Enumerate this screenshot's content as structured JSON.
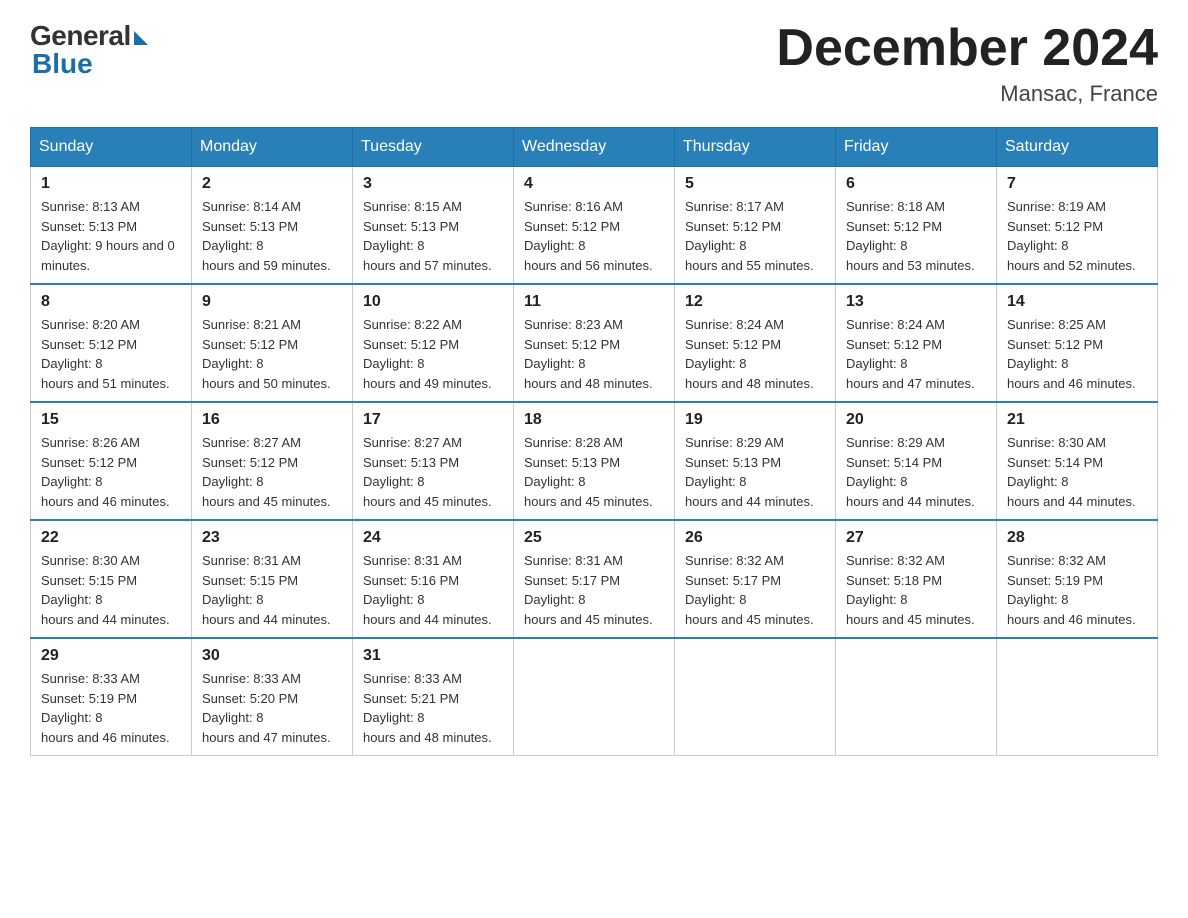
{
  "header": {
    "logo_general": "General",
    "logo_blue": "Blue",
    "month_title": "December 2024",
    "location": "Mansac, France"
  },
  "days_of_week": [
    "Sunday",
    "Monday",
    "Tuesday",
    "Wednesday",
    "Thursday",
    "Friday",
    "Saturday"
  ],
  "weeks": [
    [
      {
        "day": "1",
        "sunrise": "8:13 AM",
        "sunset": "5:13 PM",
        "daylight": "9 hours and 0 minutes."
      },
      {
        "day": "2",
        "sunrise": "8:14 AM",
        "sunset": "5:13 PM",
        "daylight": "8 hours and 59 minutes."
      },
      {
        "day": "3",
        "sunrise": "8:15 AM",
        "sunset": "5:13 PM",
        "daylight": "8 hours and 57 minutes."
      },
      {
        "day": "4",
        "sunrise": "8:16 AM",
        "sunset": "5:12 PM",
        "daylight": "8 hours and 56 minutes."
      },
      {
        "day": "5",
        "sunrise": "8:17 AM",
        "sunset": "5:12 PM",
        "daylight": "8 hours and 55 minutes."
      },
      {
        "day": "6",
        "sunrise": "8:18 AM",
        "sunset": "5:12 PM",
        "daylight": "8 hours and 53 minutes."
      },
      {
        "day": "7",
        "sunrise": "8:19 AM",
        "sunset": "5:12 PM",
        "daylight": "8 hours and 52 minutes."
      }
    ],
    [
      {
        "day": "8",
        "sunrise": "8:20 AM",
        "sunset": "5:12 PM",
        "daylight": "8 hours and 51 minutes."
      },
      {
        "day": "9",
        "sunrise": "8:21 AM",
        "sunset": "5:12 PM",
        "daylight": "8 hours and 50 minutes."
      },
      {
        "day": "10",
        "sunrise": "8:22 AM",
        "sunset": "5:12 PM",
        "daylight": "8 hours and 49 minutes."
      },
      {
        "day": "11",
        "sunrise": "8:23 AM",
        "sunset": "5:12 PM",
        "daylight": "8 hours and 48 minutes."
      },
      {
        "day": "12",
        "sunrise": "8:24 AM",
        "sunset": "5:12 PM",
        "daylight": "8 hours and 48 minutes."
      },
      {
        "day": "13",
        "sunrise": "8:24 AM",
        "sunset": "5:12 PM",
        "daylight": "8 hours and 47 minutes."
      },
      {
        "day": "14",
        "sunrise": "8:25 AM",
        "sunset": "5:12 PM",
        "daylight": "8 hours and 46 minutes."
      }
    ],
    [
      {
        "day": "15",
        "sunrise": "8:26 AM",
        "sunset": "5:12 PM",
        "daylight": "8 hours and 46 minutes."
      },
      {
        "day": "16",
        "sunrise": "8:27 AM",
        "sunset": "5:12 PM",
        "daylight": "8 hours and 45 minutes."
      },
      {
        "day": "17",
        "sunrise": "8:27 AM",
        "sunset": "5:13 PM",
        "daylight": "8 hours and 45 minutes."
      },
      {
        "day": "18",
        "sunrise": "8:28 AM",
        "sunset": "5:13 PM",
        "daylight": "8 hours and 45 minutes."
      },
      {
        "day": "19",
        "sunrise": "8:29 AM",
        "sunset": "5:13 PM",
        "daylight": "8 hours and 44 minutes."
      },
      {
        "day": "20",
        "sunrise": "8:29 AM",
        "sunset": "5:14 PM",
        "daylight": "8 hours and 44 minutes."
      },
      {
        "day": "21",
        "sunrise": "8:30 AM",
        "sunset": "5:14 PM",
        "daylight": "8 hours and 44 minutes."
      }
    ],
    [
      {
        "day": "22",
        "sunrise": "8:30 AM",
        "sunset": "5:15 PM",
        "daylight": "8 hours and 44 minutes."
      },
      {
        "day": "23",
        "sunrise": "8:31 AM",
        "sunset": "5:15 PM",
        "daylight": "8 hours and 44 minutes."
      },
      {
        "day": "24",
        "sunrise": "8:31 AM",
        "sunset": "5:16 PM",
        "daylight": "8 hours and 44 minutes."
      },
      {
        "day": "25",
        "sunrise": "8:31 AM",
        "sunset": "5:17 PM",
        "daylight": "8 hours and 45 minutes."
      },
      {
        "day": "26",
        "sunrise": "8:32 AM",
        "sunset": "5:17 PM",
        "daylight": "8 hours and 45 minutes."
      },
      {
        "day": "27",
        "sunrise": "8:32 AM",
        "sunset": "5:18 PM",
        "daylight": "8 hours and 45 minutes."
      },
      {
        "day": "28",
        "sunrise": "8:32 AM",
        "sunset": "5:19 PM",
        "daylight": "8 hours and 46 minutes."
      }
    ],
    [
      {
        "day": "29",
        "sunrise": "8:33 AM",
        "sunset": "5:19 PM",
        "daylight": "8 hours and 46 minutes."
      },
      {
        "day": "30",
        "sunrise": "8:33 AM",
        "sunset": "5:20 PM",
        "daylight": "8 hours and 47 minutes."
      },
      {
        "day": "31",
        "sunrise": "8:33 AM",
        "sunset": "5:21 PM",
        "daylight": "8 hours and 48 minutes."
      },
      null,
      null,
      null,
      null
    ]
  ]
}
